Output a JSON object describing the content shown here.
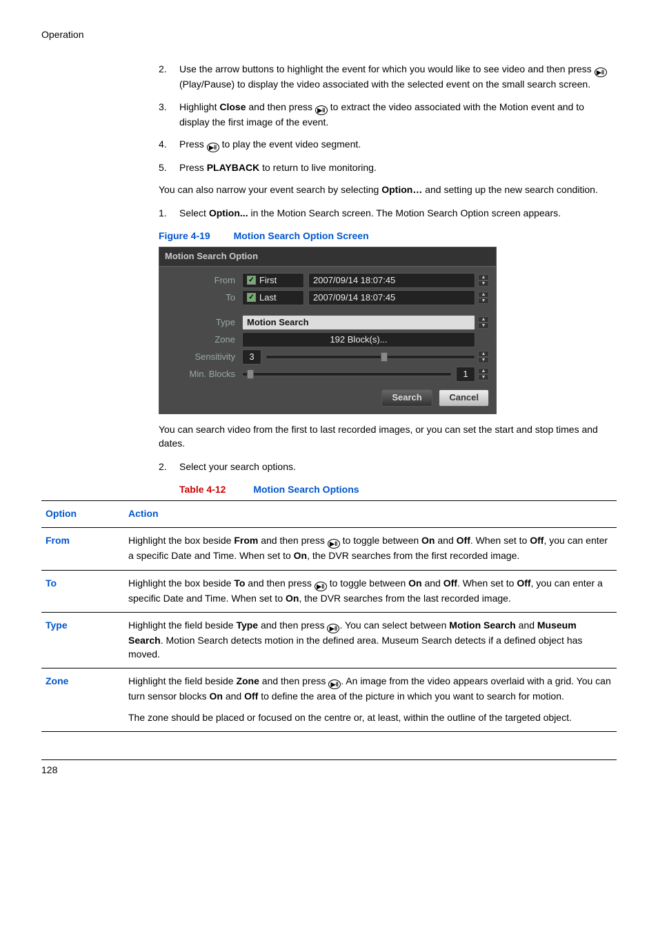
{
  "header": "Operation",
  "steps_a": [
    {
      "num": "2.",
      "text_a": "Use the arrow buttons to highlight the event for which you would like to see video and then press ",
      "icon": true,
      "text_b": " (Play/Pause) to display the video associated with the selected event on the small search screen."
    },
    {
      "num": "3.",
      "text_a": "Highlight ",
      "bold1": "Close",
      "text_b": " and then press ",
      "icon": true,
      "text_c": " to extract the video associated with the Motion event and to display the first image of the event."
    },
    {
      "num": "4.",
      "text_a": "Press ",
      "icon": true,
      "text_b": " to play the event video segment."
    },
    {
      "num": "5.",
      "text_a": "Press ",
      "bold1": "PLAYBACK",
      "text_b": " to return to live monitoring."
    }
  ],
  "intro1": "You can also narrow your event search by selecting ",
  "intro1b": "Option…",
  "intro1c": " and setting up the new search condition.",
  "steps_b": [
    {
      "num": "1.",
      "text_a": "Select ",
      "bold1": "Option...",
      "text_b": " in the Motion Search screen. The Motion Search Option screen appears."
    }
  ],
  "figure": {
    "label": "Figure 4-19",
    "title": "Motion Search Option Screen"
  },
  "panel": {
    "title": "Motion Search Option",
    "rows": {
      "from": {
        "label": "From",
        "check": "First",
        "date": "2007/09/14  18:07:45"
      },
      "to": {
        "label": "To",
        "check": "Last",
        "date": "2007/09/14  18:07:45"
      },
      "type": {
        "label": "Type",
        "value": "Motion Search"
      },
      "zone": {
        "label": "Zone",
        "value": "192 Block(s)..."
      },
      "sensitivity": {
        "label": "Sensitivity",
        "value": "3"
      },
      "minblocks": {
        "label": "Min. Blocks",
        "value": "1"
      }
    },
    "buttons": {
      "search": "Search",
      "cancel": "Cancel"
    }
  },
  "after_panel": "You can search video from the first to last recorded images, or you can set the start and stop times and dates.",
  "steps_c": [
    {
      "num": "2.",
      "text": "Select your search options."
    }
  ],
  "table_caption": {
    "label": "Table 4-12",
    "title": "Motion Search Options"
  },
  "table": {
    "headers": {
      "option": "Option",
      "action": "Action"
    },
    "rows": [
      {
        "name": "From",
        "a1": "Highlight the box beside ",
        "b1": "From",
        "a2": " and then press ",
        "a3": " to toggle between ",
        "b2": "On",
        "a4": " and ",
        "b3": "Off",
        "a5": ". When set to ",
        "b4": "Off",
        "a6": ", you can enter a specific Date and Time. When set to ",
        "b5": "On",
        "a7": ", the DVR searches from the first recorded image."
      },
      {
        "name": "To",
        "a1": "Highlight the box beside ",
        "b1": "To",
        "a2": " and then press ",
        "a3": " to toggle between ",
        "b2": "On",
        "a4": " and ",
        "b3": "Off",
        "a5": ". When set to ",
        "b4": "Off",
        "a6": ", you can enter a specific Date and Time. When set to ",
        "b5": "On",
        "a7": ", the DVR searches from the last recorded image."
      },
      {
        "name": "Type",
        "a1": "Highlight the field beside ",
        "b1": "Type",
        "a2": " and then press ",
        "a3": ". You can select between ",
        "b2": "Motion Search",
        "a4": " and ",
        "b3": "Museum Search",
        "a5": ". Motion Search detects motion in the defined area. Museum Search detects if a defined object has moved."
      },
      {
        "name": "Zone",
        "a1": "Highlight the field beside ",
        "b1": "Zone",
        "a2": " and then press ",
        "a3": ". An image from the video appears overlaid with a grid. You can turn sensor blocks ",
        "b2": "On",
        "a4": " and ",
        "b3": "Off",
        "a5": " to define the area of the picture in which you want to search for motion.",
        "sub": "The zone should be placed or focused on the centre or, at least, within the outline of the targeted object."
      }
    ]
  },
  "page_num": "128"
}
